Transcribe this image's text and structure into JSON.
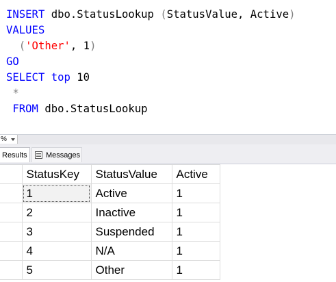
{
  "editor": {
    "line1": {
      "kw": "INSERT",
      "obj": " dbo.StatusLookup ",
      "open": "(",
      "cols": "StatusValue, Active",
      "close": ")"
    },
    "line2": {
      "kw": "VALUES"
    },
    "line3": {
      "indent": "  ",
      "open": "(",
      "str": "'Other'",
      "comma": ", 1",
      "close": ")"
    },
    "line4": {
      "kw": "GO"
    },
    "line5": {
      "kw1": "SELECT",
      "kw2": " top",
      "num": " 10"
    },
    "line6": {
      "indent": " ",
      "star": "*"
    },
    "line7": {
      "indent": " ",
      "kw": "FROM",
      "obj": " dbo.StatusLookup"
    }
  },
  "zoom": {
    "value": "%"
  },
  "tabs": {
    "results": "Results",
    "messages": "Messages"
  },
  "grid": {
    "columns": [
      "StatusKey",
      "StatusValue",
      "Active"
    ],
    "rows": [
      [
        "1",
        "Active",
        "1"
      ],
      [
        "2",
        "Inactive",
        "1"
      ],
      [
        "3",
        "Suspended",
        "1"
      ],
      [
        "4",
        "N/A",
        "1"
      ],
      [
        "5",
        "Other",
        "1"
      ]
    ]
  }
}
